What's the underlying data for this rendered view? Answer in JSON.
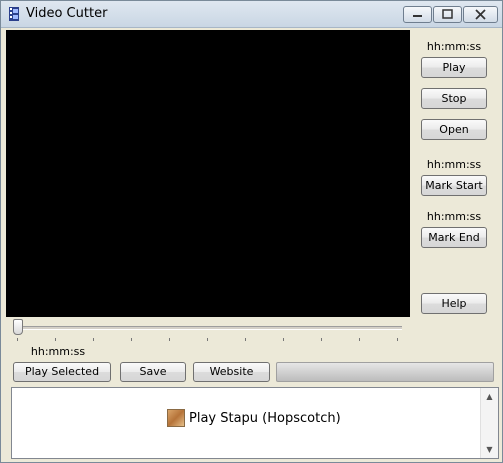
{
  "window": {
    "title": "Video Cutter"
  },
  "side": {
    "position_time": "hh:mm:ss",
    "play_label": "Play",
    "stop_label": "Stop",
    "open_label": "Open",
    "mark_start_time": "hh:mm:ss",
    "mark_start_label": "Mark Start",
    "mark_end_time": "hh:mm:ss",
    "mark_end_label": "Mark End",
    "help_label": "Help"
  },
  "bottom": {
    "selection_time": "hh:mm:ss",
    "play_selected_label": "Play Selected",
    "save_label": "Save",
    "website_label": "Website",
    "progress_percent": 0
  },
  "list": {
    "items": [
      {
        "label": "Play Stapu (Hopscotch)"
      }
    ]
  },
  "icons": {
    "app": "film-icon",
    "minimize": "minimize-icon",
    "maximize": "maximize-icon",
    "close": "close-icon"
  }
}
